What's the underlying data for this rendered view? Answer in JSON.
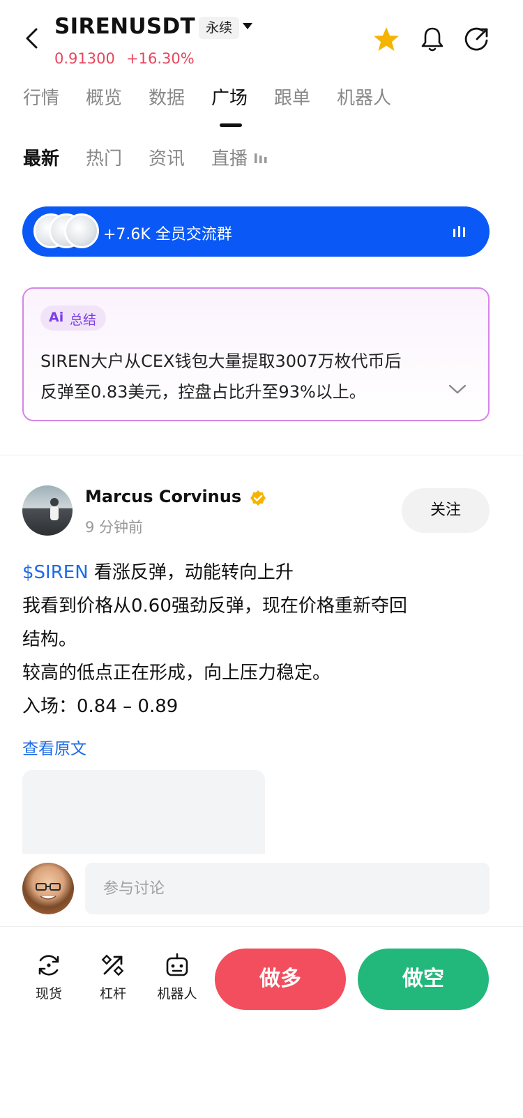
{
  "header": {
    "symbol": "SIRENUSDT",
    "contract_type": "永续",
    "price": "0.91300",
    "change": "+16.30%"
  },
  "tabs": [
    "行情",
    "概览",
    "数据",
    "广场",
    "跟单",
    "机器人"
  ],
  "active_tab": "广场",
  "subtabs": [
    "最新",
    "热门",
    "资讯",
    "直播"
  ],
  "active_subtab": "最新",
  "group_banner": {
    "text": "+7.6K 全员交流群"
  },
  "ai_summary": {
    "badge_logo": "Ai",
    "badge_label": "总结",
    "lines": [
      "SIREN大户从CEX钱包大量提取3007万枚代币后",
      "反弹至0.83美元，控盘占比升至93%以上。"
    ]
  },
  "post": {
    "author": "Marcus Corvinus",
    "time": "9 分钟前",
    "follow_label": "关注",
    "cashtag": "$SIREN",
    "first_line_rest": " 看涨反弹，动能转向上升",
    "lines": [
      "我看到价格从0.60强劲反弹，现在价格重新夺回",
      "结构。",
      "较高的低点正在形成，向上压力稳定。",
      "入场：0.84 – 0.89"
    ],
    "view_original": "查看原文"
  },
  "comment": {
    "placeholder": "参与讨论"
  },
  "bottom_bar": {
    "items": [
      {
        "label": "现货",
        "icon": "spot-icon"
      },
      {
        "label": "杠杆",
        "icon": "leverage-icon"
      },
      {
        "label": "机器人",
        "icon": "robot-icon"
      }
    ],
    "long_label": "做多",
    "short_label": "做空"
  },
  "colors": {
    "price_red": "#e8455e",
    "banner_blue": "#0a59f6",
    "long_red": "#f24e5e",
    "short_green": "#22b87b",
    "link_blue": "#1d6ae5",
    "star_gold": "#f5b400"
  }
}
